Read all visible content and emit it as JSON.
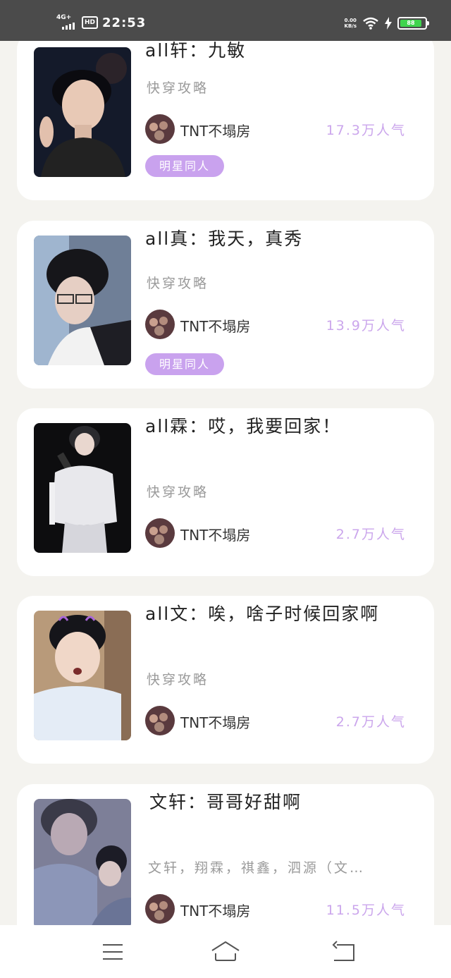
{
  "status_bar": {
    "network": "4G+",
    "hd": "HD",
    "time": "22:53",
    "speed_value": "0.00",
    "speed_unit": "KB/s",
    "battery": "88"
  },
  "cards": [
    {
      "title": "all轩：九敏",
      "category": "快穿攻略",
      "author": "TNT不塌房",
      "popularity": "17.3万人气",
      "tag": "明星同人"
    },
    {
      "title": "all真：我天，真秀",
      "category": "快穿攻略",
      "author": "TNT不塌房",
      "popularity": "13.9万人气",
      "tag": "明星同人"
    },
    {
      "title": "all霖：哎，我要回家！",
      "category": "快穿攻略",
      "author": "TNT不塌房",
      "popularity": "2.7万人气"
    },
    {
      "title": "all文：唉，啥子时候回家啊",
      "category": "快穿攻略",
      "author": "TNT不塌房",
      "popularity": "2.7万人气"
    },
    {
      "title": "文轩：哥哥好甜啊",
      "category": "文轩，翔霖，祺鑫，泗源（文…",
      "author": "TNT不塌房",
      "popularity": "11.5万人气"
    }
  ],
  "nav": {
    "menu": "menu-icon",
    "home": "home-icon",
    "back": "back-icon"
  }
}
